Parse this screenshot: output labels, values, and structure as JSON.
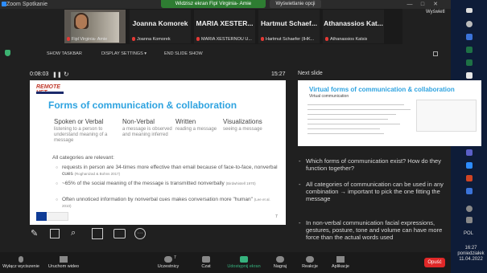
{
  "window": {
    "title": "Zoom Spotkanie",
    "viewing_banner": "Widzisz ekran Fipl Virginia- Amie",
    "view_options": "Wyświetlanie opcji"
  },
  "participants": [
    {
      "big": "",
      "small": "Fipl Virginia- Amie"
    },
    {
      "big": "Joanna Komorek",
      "small": "Joanna Komorek"
    },
    {
      "big": "MARIA  XESTER...",
      "small": "MARIA XESTERNOU U..."
    },
    {
      "big": "Hartmut  Schaef...",
      "small": "Hartmut Schaefer (IHK..."
    },
    {
      "big": "Athanassios  Kat...",
      "small": "Athanassios Katsis"
    }
  ],
  "toolbar": {
    "show_taskbar": "SHOW TASKBAR",
    "display_settings": "DISPLAY SETTINGS ▾",
    "end_slide_show": "END SLIDE SHOW"
  },
  "presenter": {
    "timer": "0:08:03",
    "elapsed": "15:27",
    "next_label": "Next slide"
  },
  "slide": {
    "logo": "REMOTE VET",
    "title": "Forms of communication & collaboration",
    "columns": [
      {
        "head": "Spoken or Verbal",
        "desc": "listening to a person to understand meaning of a message"
      },
      {
        "head": "Non-Verbal",
        "desc": "a message is observed and meaning inferred"
      },
      {
        "head": "Written",
        "desc": "reading a message"
      },
      {
        "head": "Visualizations",
        "desc": "seeing a message"
      }
    ],
    "all_categories": "All categories are relevant:",
    "bullets": [
      {
        "text": "requests in person are 34-times more effective than email because of face-to-face, nonverbal cues",
        "ref": "(Roghanizad & Bohns 2017)"
      },
      {
        "text": "~65% of the social meaning of the message is transmitted nonverbally",
        "ref": "(Birdwhistell 1970)"
      },
      {
        "text": "Often unnoticed information by nonverbal cues makes conversation more \"human\"",
        "ref": "(Lee et al. 2010)"
      }
    ],
    "eu_note": "Co-funded by the Erasmus+ Programme of the European Union",
    "page_number": "7"
  },
  "next_slide": {
    "title": "Virtual forms of communication & collaboration",
    "subtitle": "Virtual communication"
  },
  "notes": [
    "Which forms of communication exist? How do they function together?",
    "All categories of communication can be used in any combination → important to pick the one fitting the message",
    "In non-verbal communication facial expressions, gestures, posture, tone and volume can have more force than the actual words used"
  ],
  "bottom": {
    "mute": "Wyłącz wyciszenie",
    "video": "Uruchom wideo",
    "participants": "Uczestnicy",
    "participants_count": "7",
    "chat": "Czat",
    "share": "Udostępnij ekran",
    "record": "Nagraj",
    "reactions": "Reakcje",
    "apps": "Aplikacje",
    "end": "Opuść"
  },
  "system": {
    "desktop": "Wyświetl",
    "lang": "POL",
    "time": "16:27",
    "day": "poniedziałek",
    "date": "11.04.2022"
  },
  "colors": {
    "accent": "#2ea3e0",
    "share_green": "#36b37e",
    "end_red": "#e02828",
    "zoom_blue": "#2d8cff"
  }
}
